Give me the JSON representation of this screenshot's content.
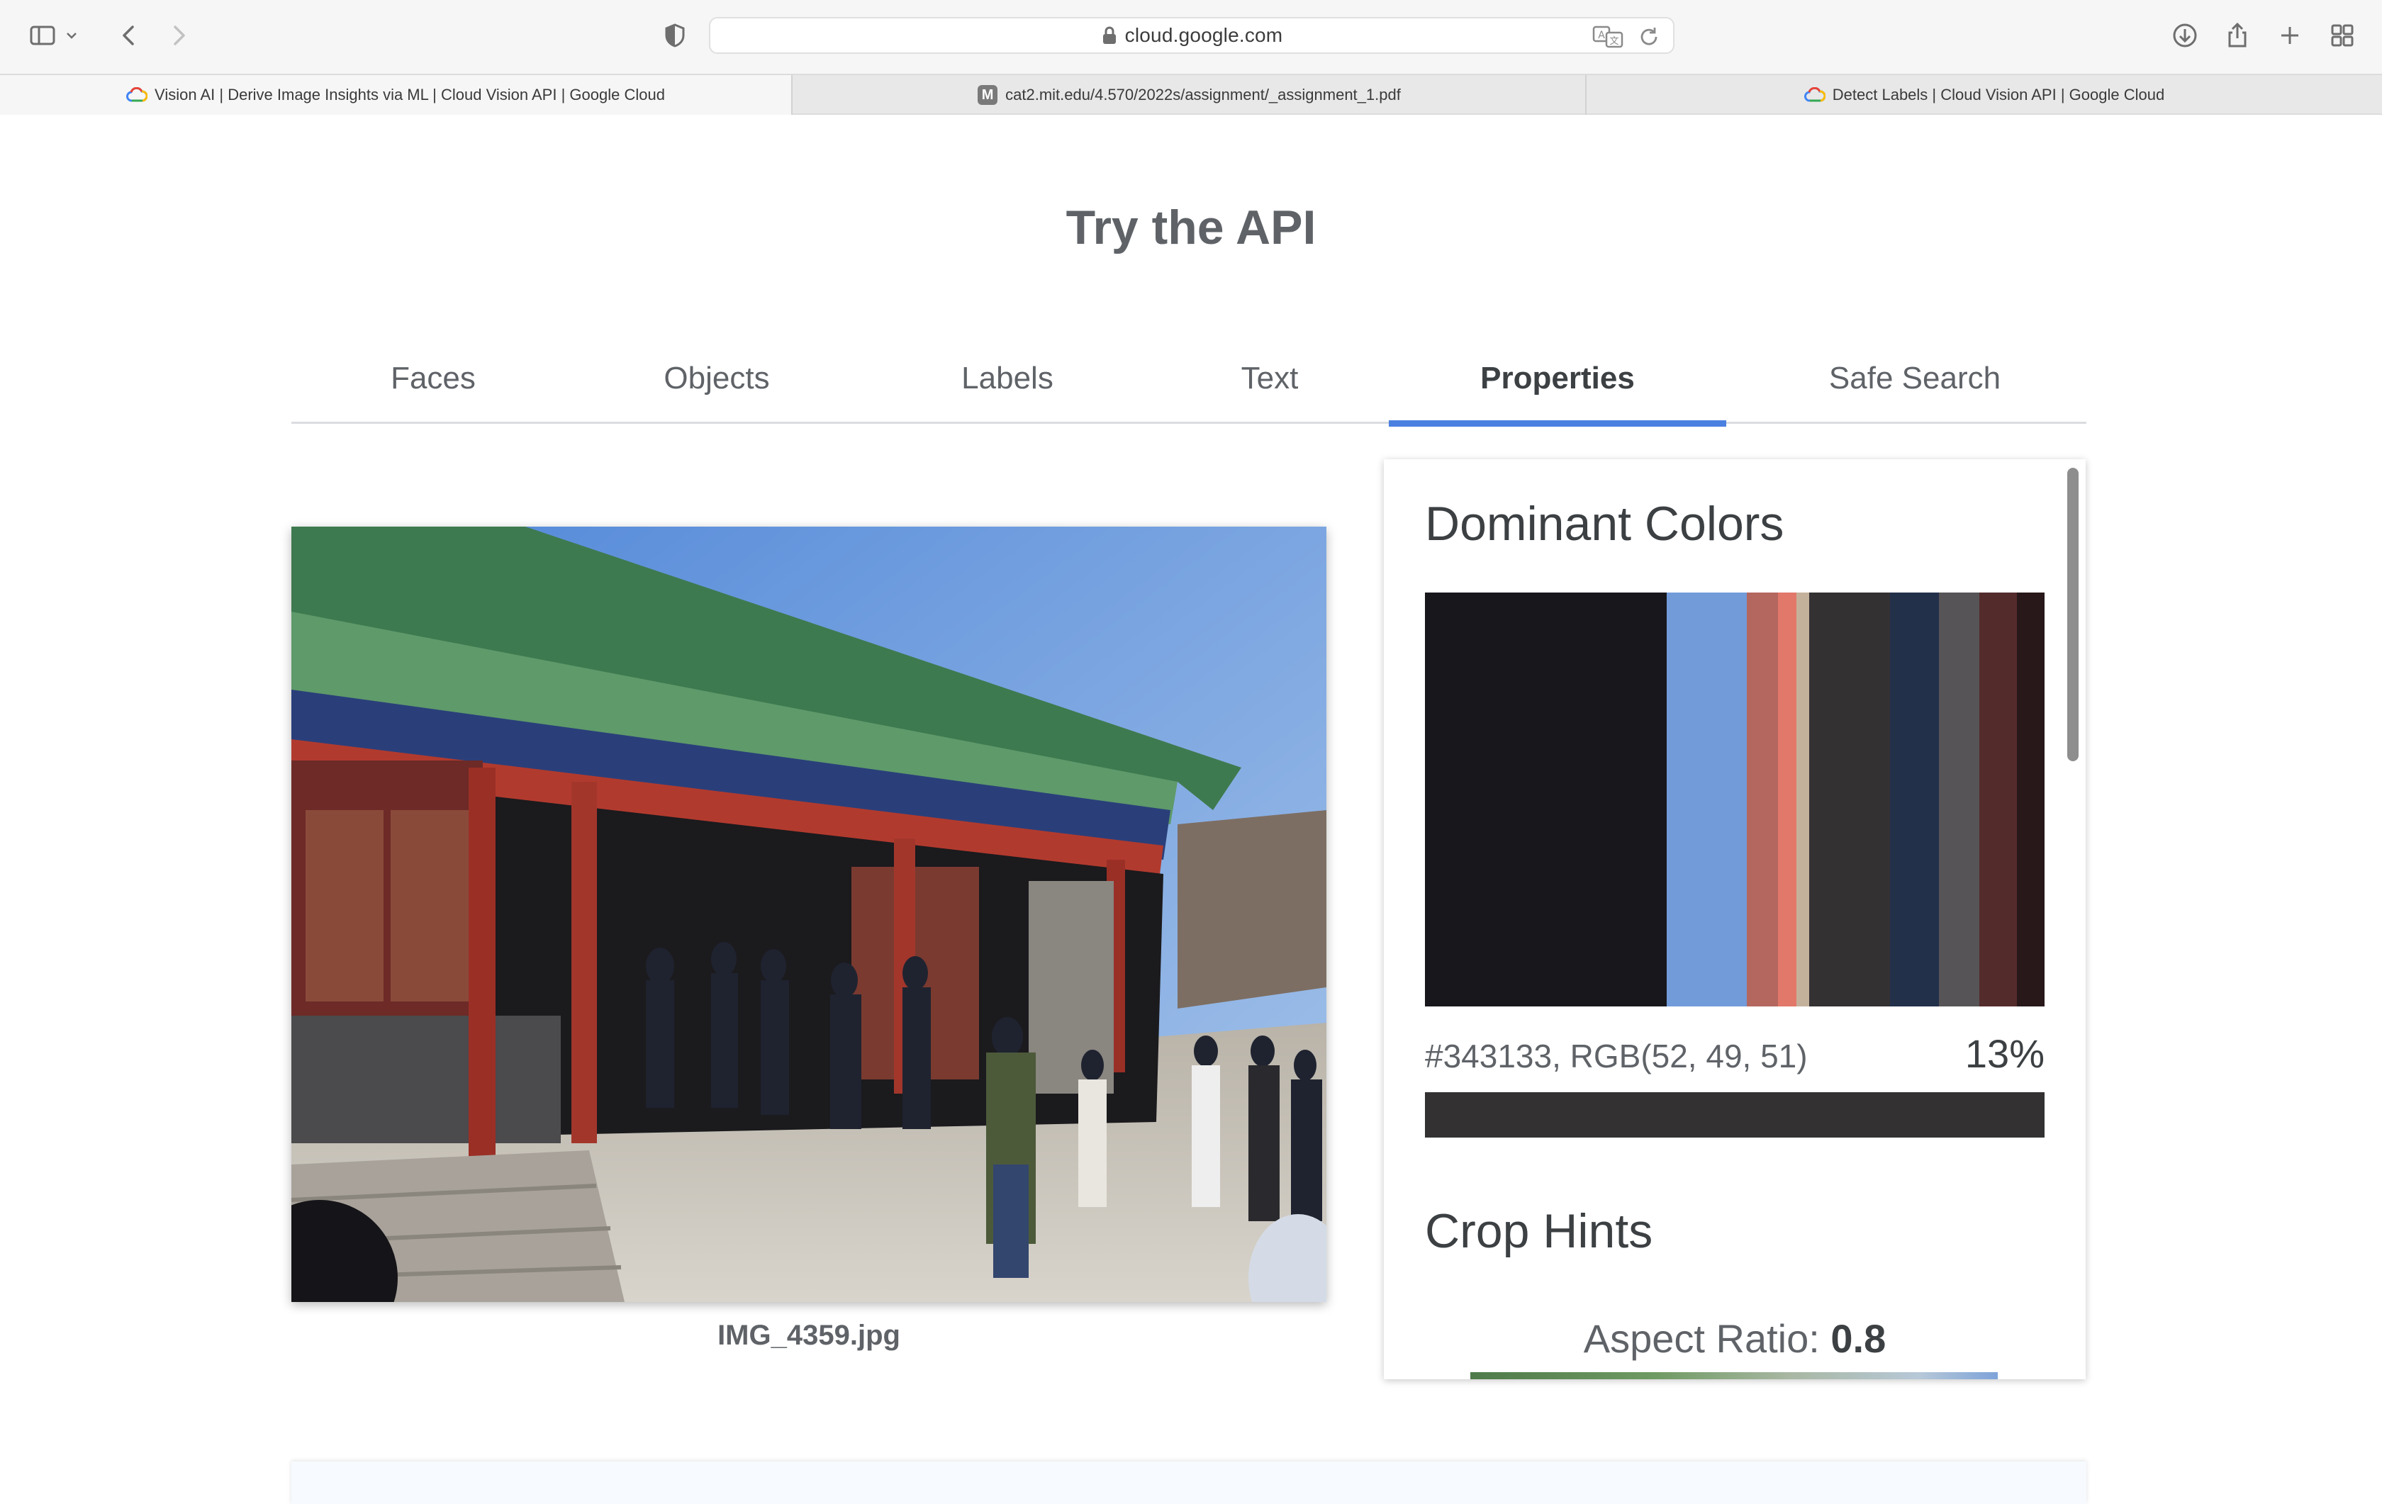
{
  "browser": {
    "url": "cloud.google.com",
    "tabs": [
      {
        "title": "Vision AI | Derive Image Insights via ML  |  Cloud Vision API  |  Google Cloud",
        "favicon": "google-cloud-icon"
      },
      {
        "title": "cat2.mit.edu/4.570/2022s/assignment/_assignment_1.pdf",
        "favicon": "m-icon",
        "favicon_letter": "M"
      },
      {
        "title": "Detect Labels  |  Cloud Vision API  |  Google Cloud",
        "favicon": "google-cloud-icon"
      }
    ],
    "toolbar_icons": [
      "sidebar-icon",
      "chevron-down-icon",
      "back-icon",
      "forward-icon",
      "privacy-shield-icon",
      "translate-icon",
      "reload-icon",
      "download-icon",
      "share-icon",
      "new-tab-icon",
      "tab-overview-icon"
    ]
  },
  "page": {
    "title": "Try the API",
    "tabs": [
      "Faces",
      "Objects",
      "Labels",
      "Text",
      "Properties",
      "Safe Search"
    ],
    "active_tab": "Properties",
    "image_filename": "IMG_4359.jpg"
  },
  "properties": {
    "dominant_colors_heading": "Dominant Colors",
    "colors": [
      {
        "hex": "#18181c",
        "share": 0.39
      },
      {
        "hex": "#729bd9",
        "share": 0.13
      },
      {
        "hex": "#b4675f",
        "share": 0.05
      },
      {
        "hex": "#e2786a",
        "share": 0.03
      },
      {
        "hex": "#c4b19c",
        "share": 0.02
      },
      {
        "hex": "#343133",
        "share": 0.13
      },
      {
        "hex": "#23304a",
        "share": 0.08
      },
      {
        "hex": "#565456",
        "share": 0.065
      },
      {
        "hex": "#542b2b",
        "share": 0.06
      },
      {
        "hex": "#28181a",
        "share": 0.045
      }
    ],
    "selected_color": {
      "label": "#343133,  RGB(52, 49, 51)",
      "percent": "13%",
      "hex": "#343133"
    },
    "crop_hints_heading": "Crop Hints",
    "aspect_ratio_label": "Aspect Ratio: ",
    "aspect_ratio_value": "0.8"
  },
  "colors": {
    "accent": "#4a80e0",
    "text_primary": "#3c4043",
    "text_secondary": "#5f6368"
  }
}
